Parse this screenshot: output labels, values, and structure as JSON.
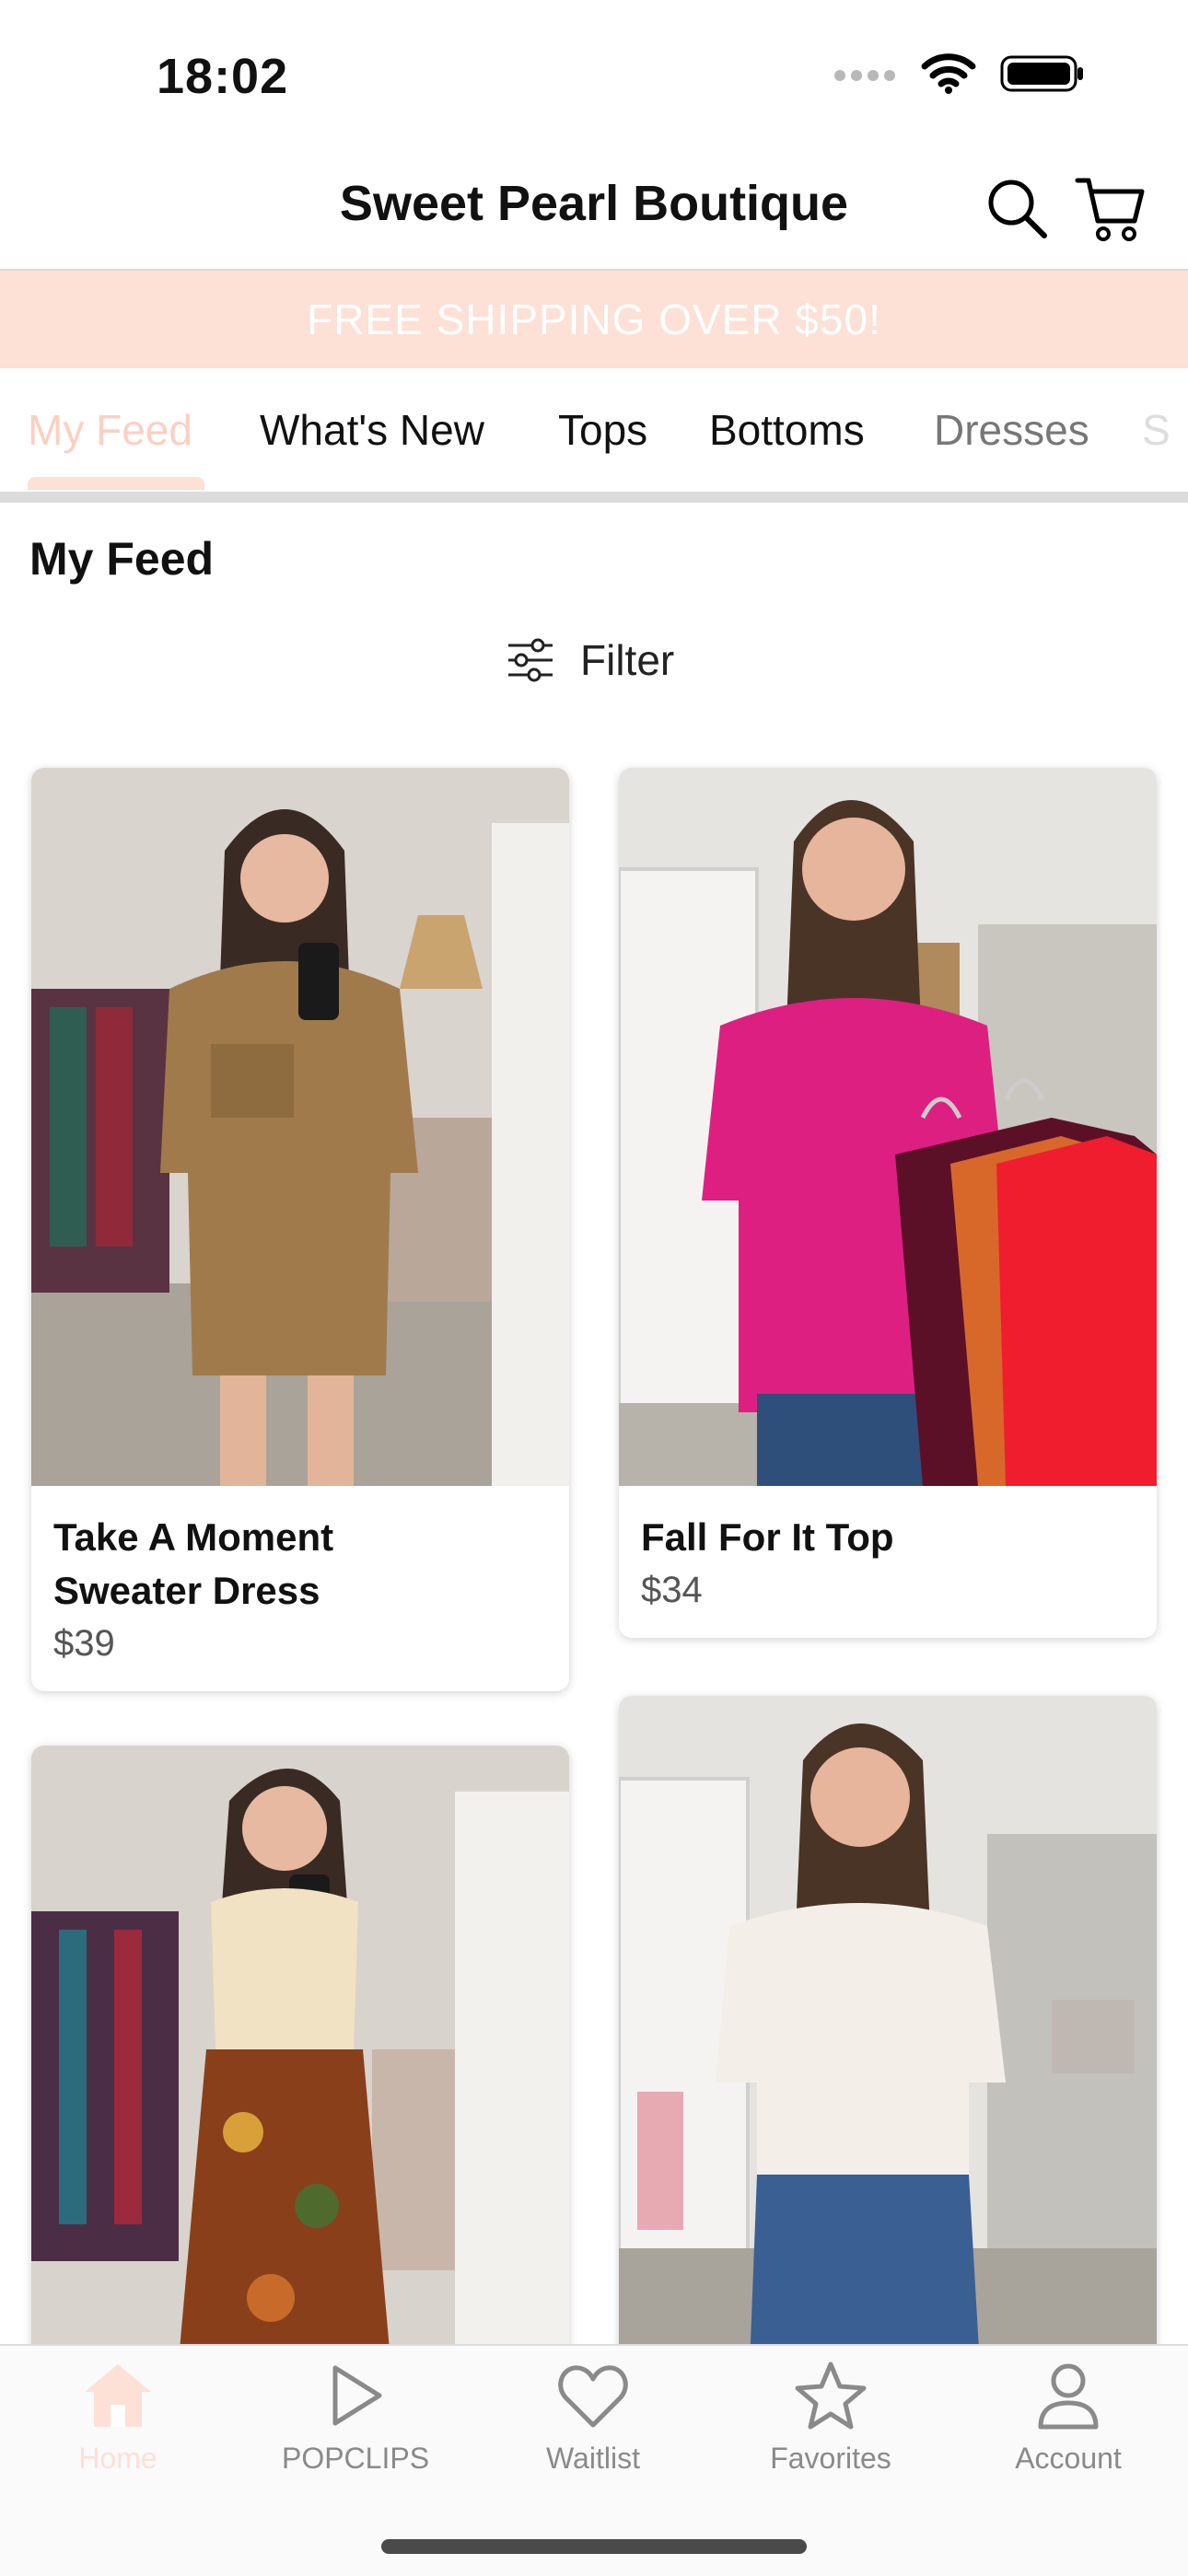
{
  "status": {
    "time": "18:02"
  },
  "header": {
    "title": "Sweet Pearl Boutique"
  },
  "promo": {
    "text": "FREE SHIPPING OVER $50!"
  },
  "tabs": [
    {
      "label": "My Feed"
    },
    {
      "label": "What's New"
    },
    {
      "label": "Tops"
    },
    {
      "label": "Bottoms"
    },
    {
      "label": "Dresses"
    },
    {
      "label": "S"
    }
  ],
  "section": {
    "title": "My Feed",
    "filter_label": "Filter"
  },
  "products": [
    {
      "name_line1": "Take A Moment",
      "name_line2": "Sweater Dress",
      "price": "$39"
    },
    {
      "name_line1": "Fall For It Top",
      "name_line2": "",
      "price": "$34"
    },
    {
      "name_line1": "",
      "name_line2": "",
      "price": ""
    },
    {
      "name_line1": "",
      "name_line2": "",
      "price": ""
    }
  ],
  "tabbar": [
    {
      "label": "Home",
      "icon": "home-icon"
    },
    {
      "label": "POPCLIPS",
      "icon": "play-icon"
    },
    {
      "label": "Waitlist",
      "icon": "heart-icon"
    },
    {
      "label": "Favorites",
      "icon": "star-icon"
    },
    {
      "label": "Account",
      "icon": "person-icon"
    }
  ],
  "colors": {
    "accent": "#fde0d6",
    "active_tab": "#fbd0c2"
  }
}
